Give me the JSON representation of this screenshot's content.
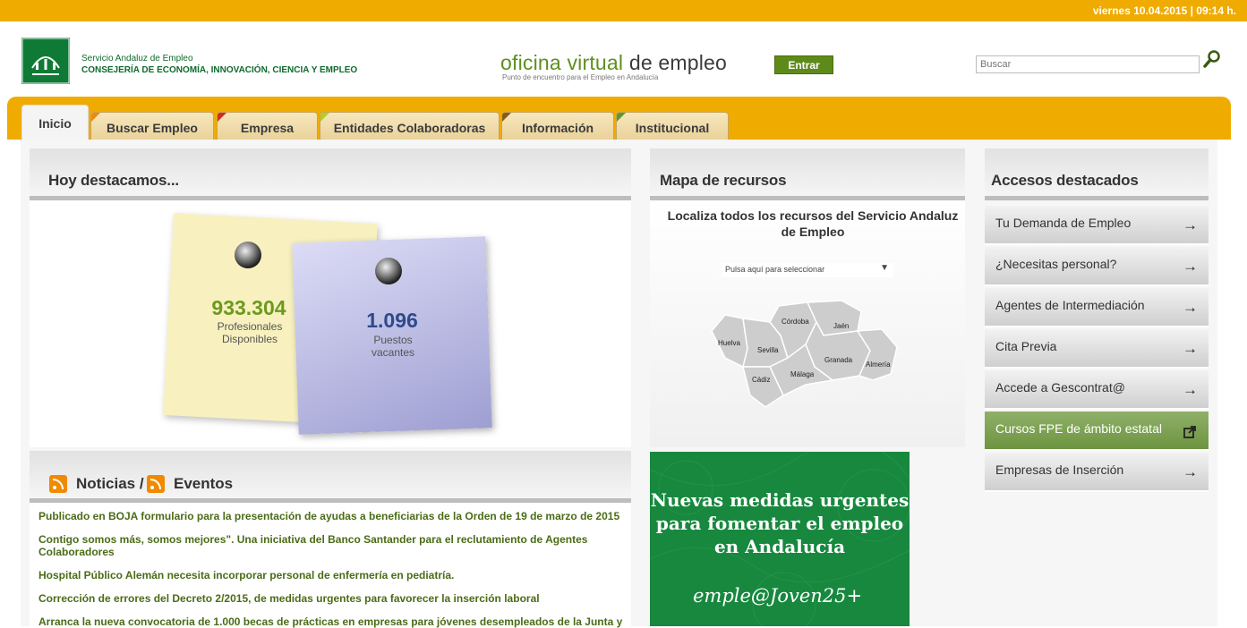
{
  "topbar": {
    "datetime": "viernes 10.04.2015 | 09:14 h."
  },
  "header": {
    "org_line1": "Servicio Andaluz de Empleo",
    "org_line2": "CONSEJERÍA DE ECONOMÍA, INNOVACIÓN, CIENCIA Y EMPLEO",
    "title_part1": "oficina virtual",
    "title_part2": " de empleo",
    "subtitle": "Punto de encuentro para el Empleo en Andalucía",
    "entrar_label": "Entrar",
    "search_placeholder": "Buscar"
  },
  "nav": {
    "tabs": [
      {
        "label": "Inicio",
        "color": ""
      },
      {
        "label": "Buscar Empleo",
        "color": "#f08a00"
      },
      {
        "label": "Empresa",
        "color": "#d32b1d"
      },
      {
        "label": "Entidades Colaboradoras",
        "color": "#b5cf1d"
      },
      {
        "label": "Información",
        "color": "#8a5a17"
      },
      {
        "label": "Institucional",
        "color": "#5c9a2b"
      }
    ]
  },
  "destacamos": {
    "heading": "Hoy destacamos...",
    "stat1": {
      "value": "933.304",
      "label_l1": "Profesionales",
      "label_l2": "Disponibles",
      "color": "#6b9a1f"
    },
    "stat2": {
      "value": "1.096",
      "label_l1": "Puestos",
      "label_l2": "vacantes",
      "color": "#2d4a8c"
    }
  },
  "mapa": {
    "heading": "Mapa de recursos",
    "title_l1": "Localiza todos los recursos del Servicio Andaluz",
    "title_l2": "de Empleo",
    "select_text": "Pulsa aquí para seleccionar",
    "provinces": [
      "Córdoba",
      "Jaén",
      "Huelva",
      "Sevilla",
      "Granada",
      "Almería",
      "Málaga",
      "Cádiz"
    ]
  },
  "noticias": {
    "heading1": "Noticias /",
    "heading2": "Eventos",
    "items": [
      "Publicado en BOJA formulario para la presentación de ayudas a beneficiarias de la Orden de 19 de marzo de 2015",
      "Contigo somos más, somos mejores\". Una iniciativa del Banco Santander para el reclutamiento de Agentes Colaboradores",
      "Hospital Público Alemán necesita incorporar personal de enfermería en pediatría.",
      "Corrección de errores del Decreto 2/2015, de medidas urgentes para favorecer la inserción laboral",
      "Arranca la nueva convocatoria de 1.000 becas de prácticas en empresas para jóvenes desempleados de la Junta y"
    ]
  },
  "promo": {
    "line1": "Nuevas medidas urgentes",
    "line2": "para fomentar el empleo",
    "line3": "en Andalucía",
    "signature": "emple@Joven25+"
  },
  "accesos": {
    "heading": "Accesos destacados",
    "items": [
      {
        "label": "Tu Demanda de Empleo",
        "icon": "arrow-right-icon"
      },
      {
        "label": "¿Necesitas personal?",
        "icon": "arrow-right-icon"
      },
      {
        "label": "Agentes de Intermediación",
        "icon": "arrow-right-icon"
      },
      {
        "label": "Cita Previa",
        "icon": "arrow-right-icon"
      },
      {
        "label": "Accede a Gescontrat@",
        "icon": "arrow-right-icon"
      },
      {
        "label": "Cursos FPE de ámbito estatal",
        "icon": "external-link-icon"
      },
      {
        "label": "Empresas de Inserción",
        "icon": "arrow-right-icon"
      }
    ]
  }
}
